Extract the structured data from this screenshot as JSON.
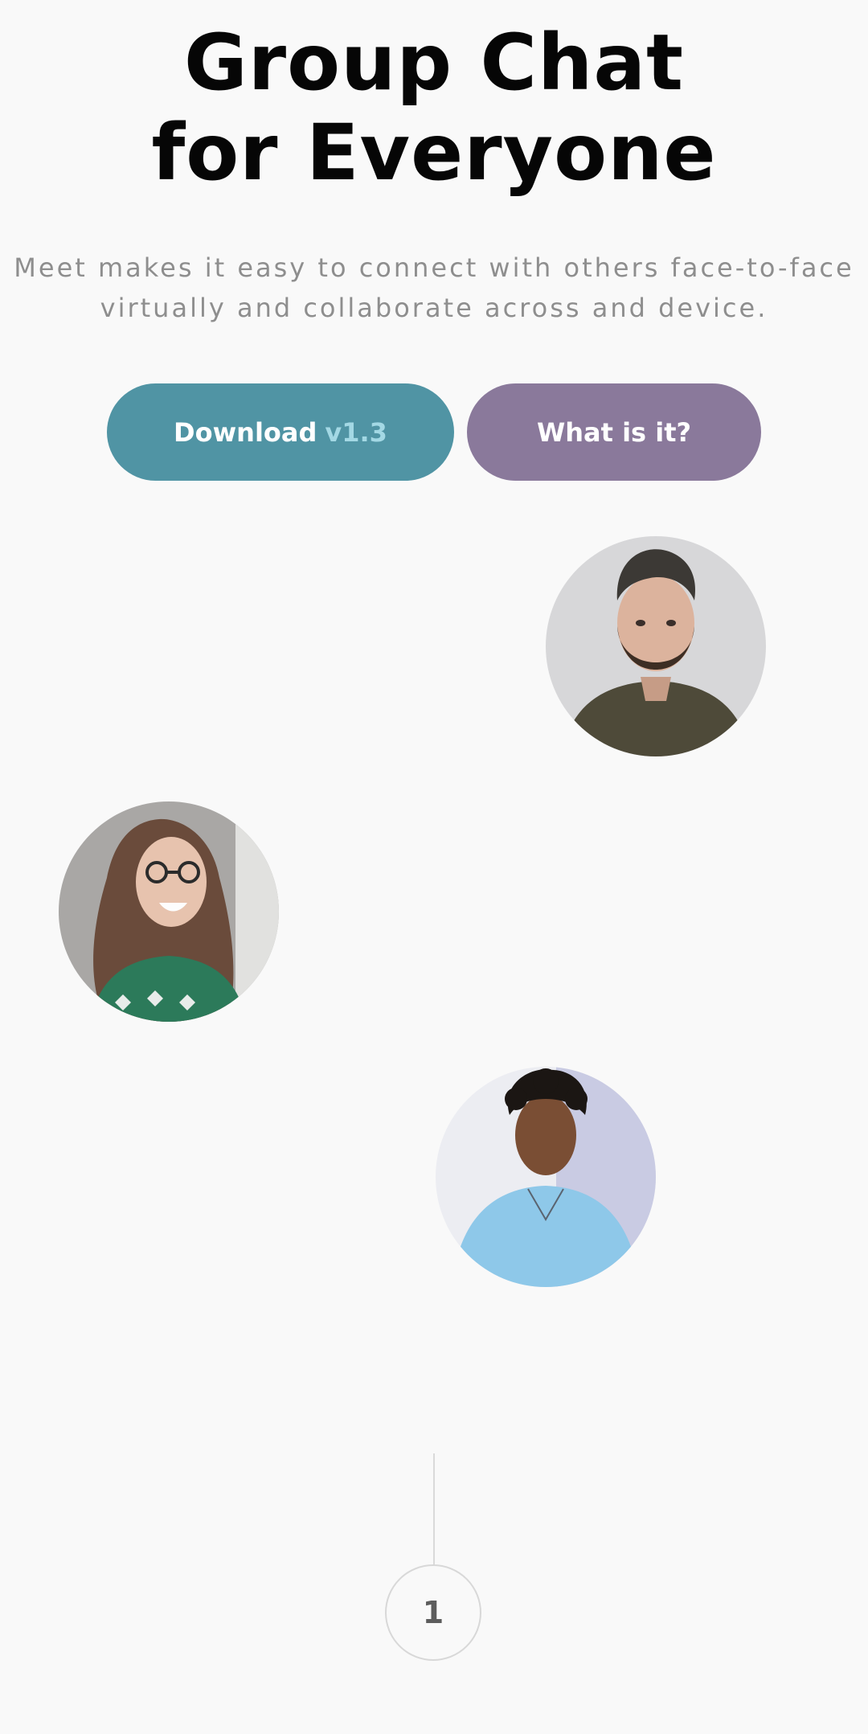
{
  "hero": {
    "title_line1": "Group Chat",
    "title_line2": "for Everyone",
    "subtitle_line1": "Meet makes it easy to connect with others face-to-face",
    "subtitle_line2": "virtually and collaborate across and device."
  },
  "buttons": {
    "download_label": "Download",
    "download_version": "v1.3",
    "what_label": "What is it?"
  },
  "avatars": {
    "man": "bearded-man-avatar",
    "woman": "woman-with-glasses-avatar",
    "teen": "curly-haired-man-avatar"
  },
  "step": {
    "number": "1"
  },
  "colors": {
    "download_button": "#5094a4",
    "download_version": "#a3d8e4",
    "what_button": "#8a799b",
    "background": "#f9f9f9"
  }
}
